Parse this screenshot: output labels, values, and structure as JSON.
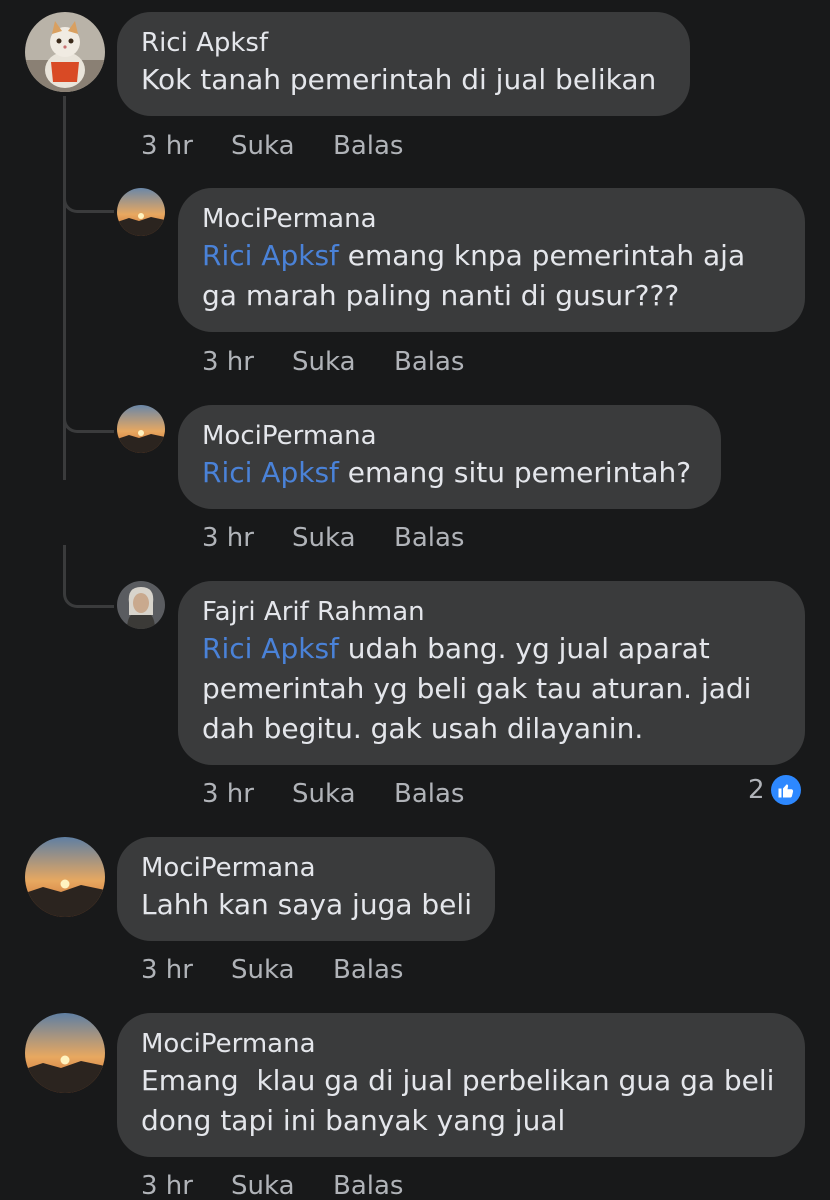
{
  "comments": [
    {
      "author": "Rici Apksf",
      "text": "Kok tanah pemerintah di jual belikan",
      "time": "3 hr",
      "like_label": "Suka",
      "reply_label": "Balas"
    },
    {
      "author": "MociPermana",
      "mention": "Rici Apksf",
      "text_line1": " emang knpa pemerintah aja",
      "text_line2": "ga marah paling nanti di gusur???",
      "time": "3 hr",
      "like_label": "Suka",
      "reply_label": "Balas"
    },
    {
      "author": "MociPermana",
      "mention": "Rici Apksf",
      "text_line1": " emang situ pemerintah?",
      "time": "3 hr",
      "like_label": "Suka",
      "reply_label": "Balas"
    },
    {
      "author": "Fajri Arif Rahman",
      "mention": "Rici Apksf",
      "text_line1": " udah bang. yg jual aparat",
      "text_line2": "pemerintah yg beli gak tau aturan. jadi",
      "text_line3": "dah begitu. gak usah dilayanin.",
      "time": "3 hr",
      "like_label": "Suka",
      "reply_label": "Balas",
      "reaction_count": "2",
      "reaction_icon": "thumbs-up-icon"
    },
    {
      "author": "MociPermana",
      "text": "Lahh kan saya juga beli",
      "time": "3 hr",
      "like_label": "Suka",
      "reply_label": "Balas"
    },
    {
      "author": "MociPermana",
      "text_line1": "Emang  klau ga di jual perbelikan gua ga beli",
      "text_line2": "dong tapi ini banyak yang jual",
      "time": "3 hr",
      "like_label": "Suka",
      "reply_label": "Balas"
    }
  ],
  "colors": {
    "background": "#18191a",
    "bubble": "#3a3b3c",
    "mention": "#4a82d8",
    "meta": "#b0b3b8",
    "like_badge": "#2d88ff"
  }
}
